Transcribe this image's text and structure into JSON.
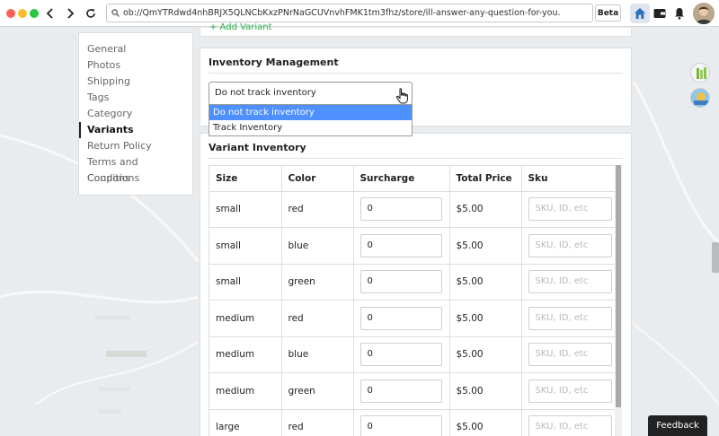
{
  "browser": {
    "url": "ob://QmYTRdwd4nhBRJX5QLNCbKxzPNrNaGCUVnvhFMK1tm3fhz/store/ill-answer-any-question-for-you.",
    "beta_label": "Beta"
  },
  "settings_nav": {
    "items": [
      {
        "label": "General",
        "active": false
      },
      {
        "label": "Photos",
        "active": false
      },
      {
        "label": "Shipping",
        "active": false
      },
      {
        "label": "Tags",
        "active": false
      },
      {
        "label": "Category",
        "active": false
      },
      {
        "label": "Variants",
        "active": true
      },
      {
        "label": "Return Policy",
        "active": false
      },
      {
        "label": "Terms and Conditions",
        "active": false
      },
      {
        "label": "Coupons",
        "active": false
      }
    ]
  },
  "top_panel": {
    "add_variant_label": "+ Add Variant"
  },
  "inventory_management": {
    "title": "Inventory Management",
    "selected": "Do not track inventory",
    "options": [
      "Do not track inventory",
      "Track Inventory"
    ]
  },
  "variant_inventory": {
    "title": "Variant Inventory",
    "columns": [
      "Size",
      "Color",
      "Surcharge",
      "Total Price",
      "Sku"
    ],
    "sku_placeholder": "SKU, ID, etc",
    "rows": [
      {
        "size": "small",
        "color": "red",
        "surcharge": "0",
        "total": "$5.00"
      },
      {
        "size": "small",
        "color": "blue",
        "surcharge": "0",
        "total": "$5.00"
      },
      {
        "size": "small",
        "color": "green",
        "surcharge": "0",
        "total": "$5.00"
      },
      {
        "size": "medium",
        "color": "red",
        "surcharge": "0",
        "total": "$5.00"
      },
      {
        "size": "medium",
        "color": "blue",
        "surcharge": "0",
        "total": "$5.00"
      },
      {
        "size": "medium",
        "color": "green",
        "surcharge": "0",
        "total": "$5.00"
      },
      {
        "size": "large",
        "color": "red",
        "surcharge": "0",
        "total": "$5.00"
      }
    ]
  },
  "feedback_label": "Feedback",
  "colors": {
    "accent_blue": "#4d90fe",
    "add_green": "#2bb24c",
    "feedback_bg": "#222222"
  }
}
